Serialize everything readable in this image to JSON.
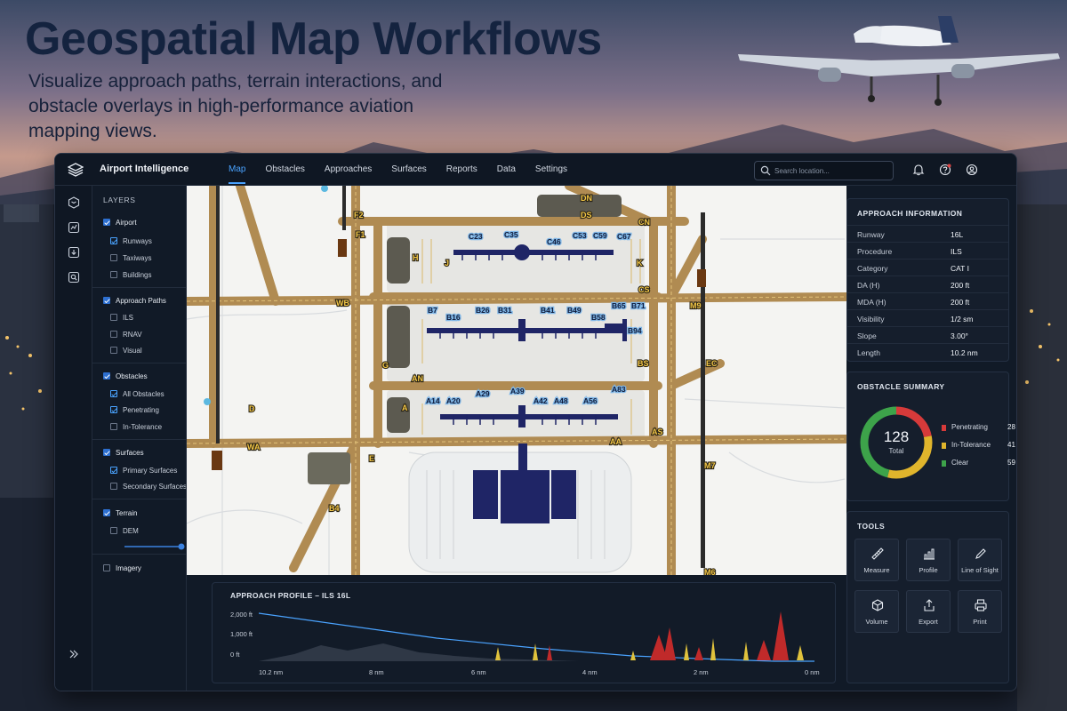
{
  "hero": {
    "headline": "Geospatial Map Workflows",
    "subhead": "Visualize approach paths, terrain interactions, and obstacle overlays in high-performance aviation mapping views."
  },
  "app": {
    "title": "Airport Intelligence",
    "nav": [
      "Map",
      "Obstacles",
      "Approaches",
      "Surfaces",
      "Reports",
      "Data",
      "Settings"
    ],
    "active_nav": "Map",
    "search_placeholder": "Search location..."
  },
  "layers": {
    "title": "LAYERS",
    "items": [
      {
        "label": "Airport",
        "checked": true,
        "level": 0
      },
      {
        "label": "Runways",
        "checked": true,
        "level": 1
      },
      {
        "label": "Taxiways",
        "checked": false,
        "level": 1
      },
      {
        "label": "Buildings",
        "checked": false,
        "level": 1
      },
      {
        "label": "Approach Paths",
        "checked": true,
        "level": 0
      },
      {
        "label": "ILS",
        "checked": false,
        "level": 1
      },
      {
        "label": "RNAV",
        "checked": false,
        "level": 1
      },
      {
        "label": "Visual",
        "checked": false,
        "level": 1
      },
      {
        "label": "Obstacles",
        "checked": true,
        "level": 0
      },
      {
        "label": "All Obstacles",
        "checked": true,
        "level": 1
      },
      {
        "label": "Penetrating",
        "checked": true,
        "level": 1
      },
      {
        "label": "In-Tolerance",
        "checked": false,
        "level": 1
      },
      {
        "label": "Surfaces",
        "checked": true,
        "level": 0
      },
      {
        "label": "Primary Surfaces",
        "checked": true,
        "level": 1
      },
      {
        "label": "Secondary Surfaces",
        "checked": false,
        "level": 1
      },
      {
        "label": "Terrain",
        "checked": true,
        "level": 0
      },
      {
        "label": "DEM",
        "checked": false,
        "level": 1
      },
      {
        "label": "Imagery",
        "checked": false,
        "level": 0
      }
    ]
  },
  "map": {
    "taxiway_labels": [
      "DN",
      "DS",
      "F2",
      "F1",
      "CN",
      "H",
      "J",
      "K",
      "CS",
      "M9",
      "WB",
      "BS",
      "EC",
      "G",
      "AN",
      "D",
      "A",
      "AS",
      "WA",
      "E",
      "AA",
      "M7",
      "M6",
      "B4"
    ],
    "gate_labels": [
      "C23",
      "C35",
      "C46",
      "C53",
      "C59",
      "C67",
      "B7",
      "B16",
      "B26",
      "B31",
      "B41",
      "B49",
      "B58",
      "B65",
      "B71",
      "B94",
      "A14",
      "A20",
      "A29",
      "A39",
      "A42",
      "A48",
      "A56",
      "A83"
    ]
  },
  "approach_info": {
    "title": "APPROACH INFORMATION",
    "rows": [
      {
        "label": "Runway",
        "value": "16L"
      },
      {
        "label": "Procedure",
        "value": "ILS"
      },
      {
        "label": "Category",
        "value": "CAT I"
      },
      {
        "label": "DA (H)",
        "value": "200 ft"
      },
      {
        "label": "MDA (H)",
        "value": "200 ft"
      },
      {
        "label": "Visibility",
        "value": "1/2 sm"
      },
      {
        "label": "Slope",
        "value": "3.00°"
      },
      {
        "label": "Length",
        "value": "10.2 nm"
      }
    ]
  },
  "obstacle_summary": {
    "title": "OBSTACLE SUMMARY",
    "total": "128",
    "total_label": "Total",
    "items": [
      {
        "label": "Penetrating",
        "count": 28,
        "color": "#d63a3a"
      },
      {
        "label": "In-Tolerance",
        "count": 41,
        "color": "#e0b52c"
      },
      {
        "label": "Clear",
        "count": 59,
        "color": "#3da34a"
      }
    ]
  },
  "tools": {
    "title": "TOOLS",
    "items": [
      {
        "label": "Measure",
        "icon": "ruler-icon"
      },
      {
        "label": "Profile",
        "icon": "bar-chart-icon"
      },
      {
        "label": "Line of Sight",
        "icon": "pencil-icon"
      },
      {
        "label": "Volume",
        "icon": "cube-icon"
      },
      {
        "label": "Export",
        "icon": "export-icon"
      },
      {
        "label": "Print",
        "icon": "printer-icon"
      }
    ]
  },
  "profile": {
    "title": "APPROACH PROFILE – ILS 16L",
    "y_ticks": [
      "2,000 ft",
      "1,000 ft",
      "0 ft"
    ],
    "x_ticks": [
      "10.2 nm",
      "8 nm",
      "6 nm",
      "4 nm",
      "2 nm",
      "0 nm"
    ]
  },
  "colors": {
    "accent": "#4aa3ff",
    "penetrating": "#d63a3a",
    "in_tolerance": "#e0b52c",
    "clear": "#3da34a",
    "taxiway": "#b0894d",
    "terminal": "#1f2566"
  }
}
